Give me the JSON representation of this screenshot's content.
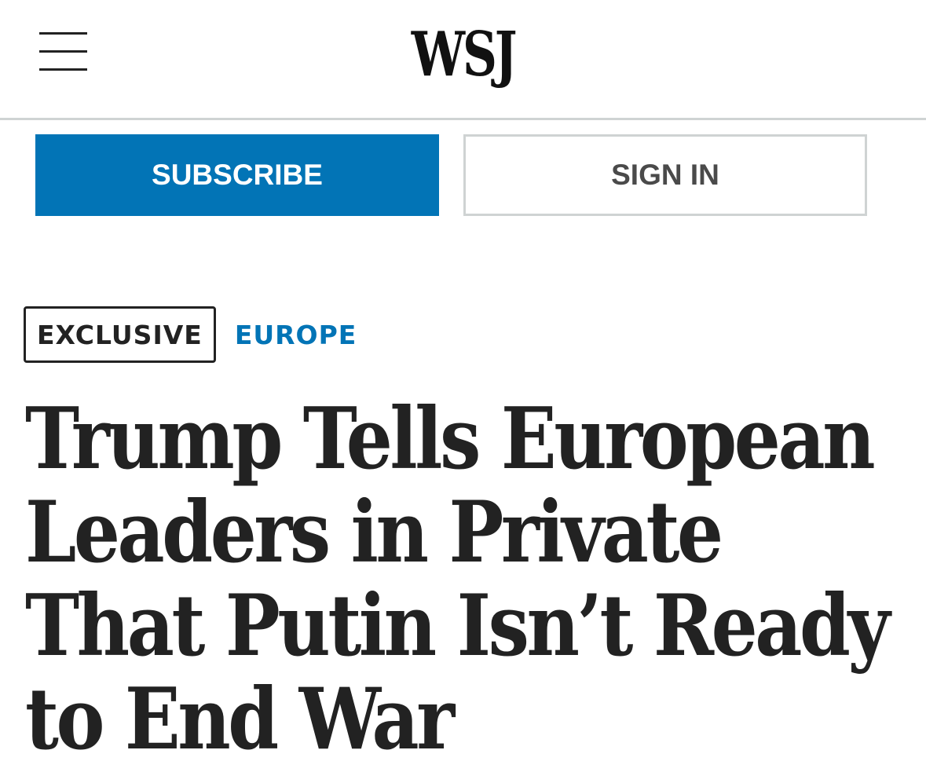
{
  "header": {
    "logo_text": "WSJ",
    "menu_icon": "hamburger-menu-icon"
  },
  "actions": {
    "subscribe_label": "SUBSCRIBE",
    "signin_label": "SIGN IN"
  },
  "article": {
    "flag_label": "EXCLUSIVE",
    "section_label": "EUROPE",
    "headline": "Trump Tells European Leaders in Private That Putin Isn’t Ready to End War"
  },
  "colors": {
    "accent_blue": "#0274b6",
    "text_dark": "#222222",
    "border_gray": "#cfd3d3"
  }
}
